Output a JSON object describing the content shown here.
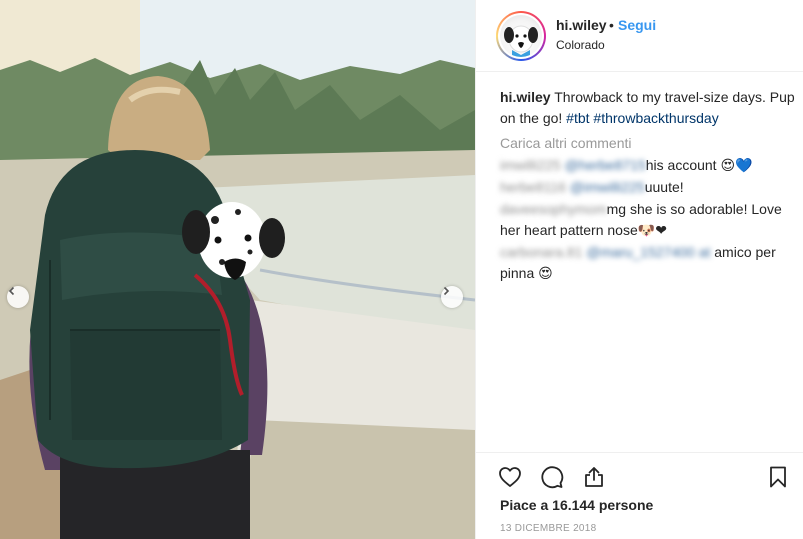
{
  "post": {
    "username": "hi.wiley",
    "separator": "•",
    "follow_label": "Segui",
    "location": "Colorado",
    "caption_user": "hi.wiley",
    "caption_text": " Throwback to my travel-size days. Pup on the go! ",
    "hashtags": [
      "#tbt",
      "#throwbackthursday"
    ],
    "load_more": "Carica altri commenti",
    "comments": [
      {
        "user_blurred": "imwilli225",
        "mention_blurred": "@herbe8715",
        "text": "his account 😍💙"
      },
      {
        "user_blurred": "herbe8116",
        "mention_blurred": "@imwilli225",
        "text": "uuute!"
      },
      {
        "user_blurred": "daveesophymom",
        "mention_blurred": "",
        "text": "mg she is so adorable! Love her heart pattern nose🐶❤"
      },
      {
        "user_blurred": "carbonara.81",
        "mention_blurred": "@maru_1527400 at",
        "text": "amico per pinna 😍"
      }
    ],
    "likes": "Piace a 16.144 persone",
    "date": "13 DICEMBRE 2018"
  },
  "icons": {
    "like": "heart-icon",
    "comment": "comment-bubble-icon",
    "share": "share-icon",
    "save": "bookmark-icon",
    "prev": "chevron-left-icon",
    "next": "chevron-right-icon"
  },
  "colors": {
    "accent": "#3897f0",
    "hashtag": "#003569",
    "muted": "#999999",
    "text": "#262626",
    "backpack": "#26413a"
  }
}
